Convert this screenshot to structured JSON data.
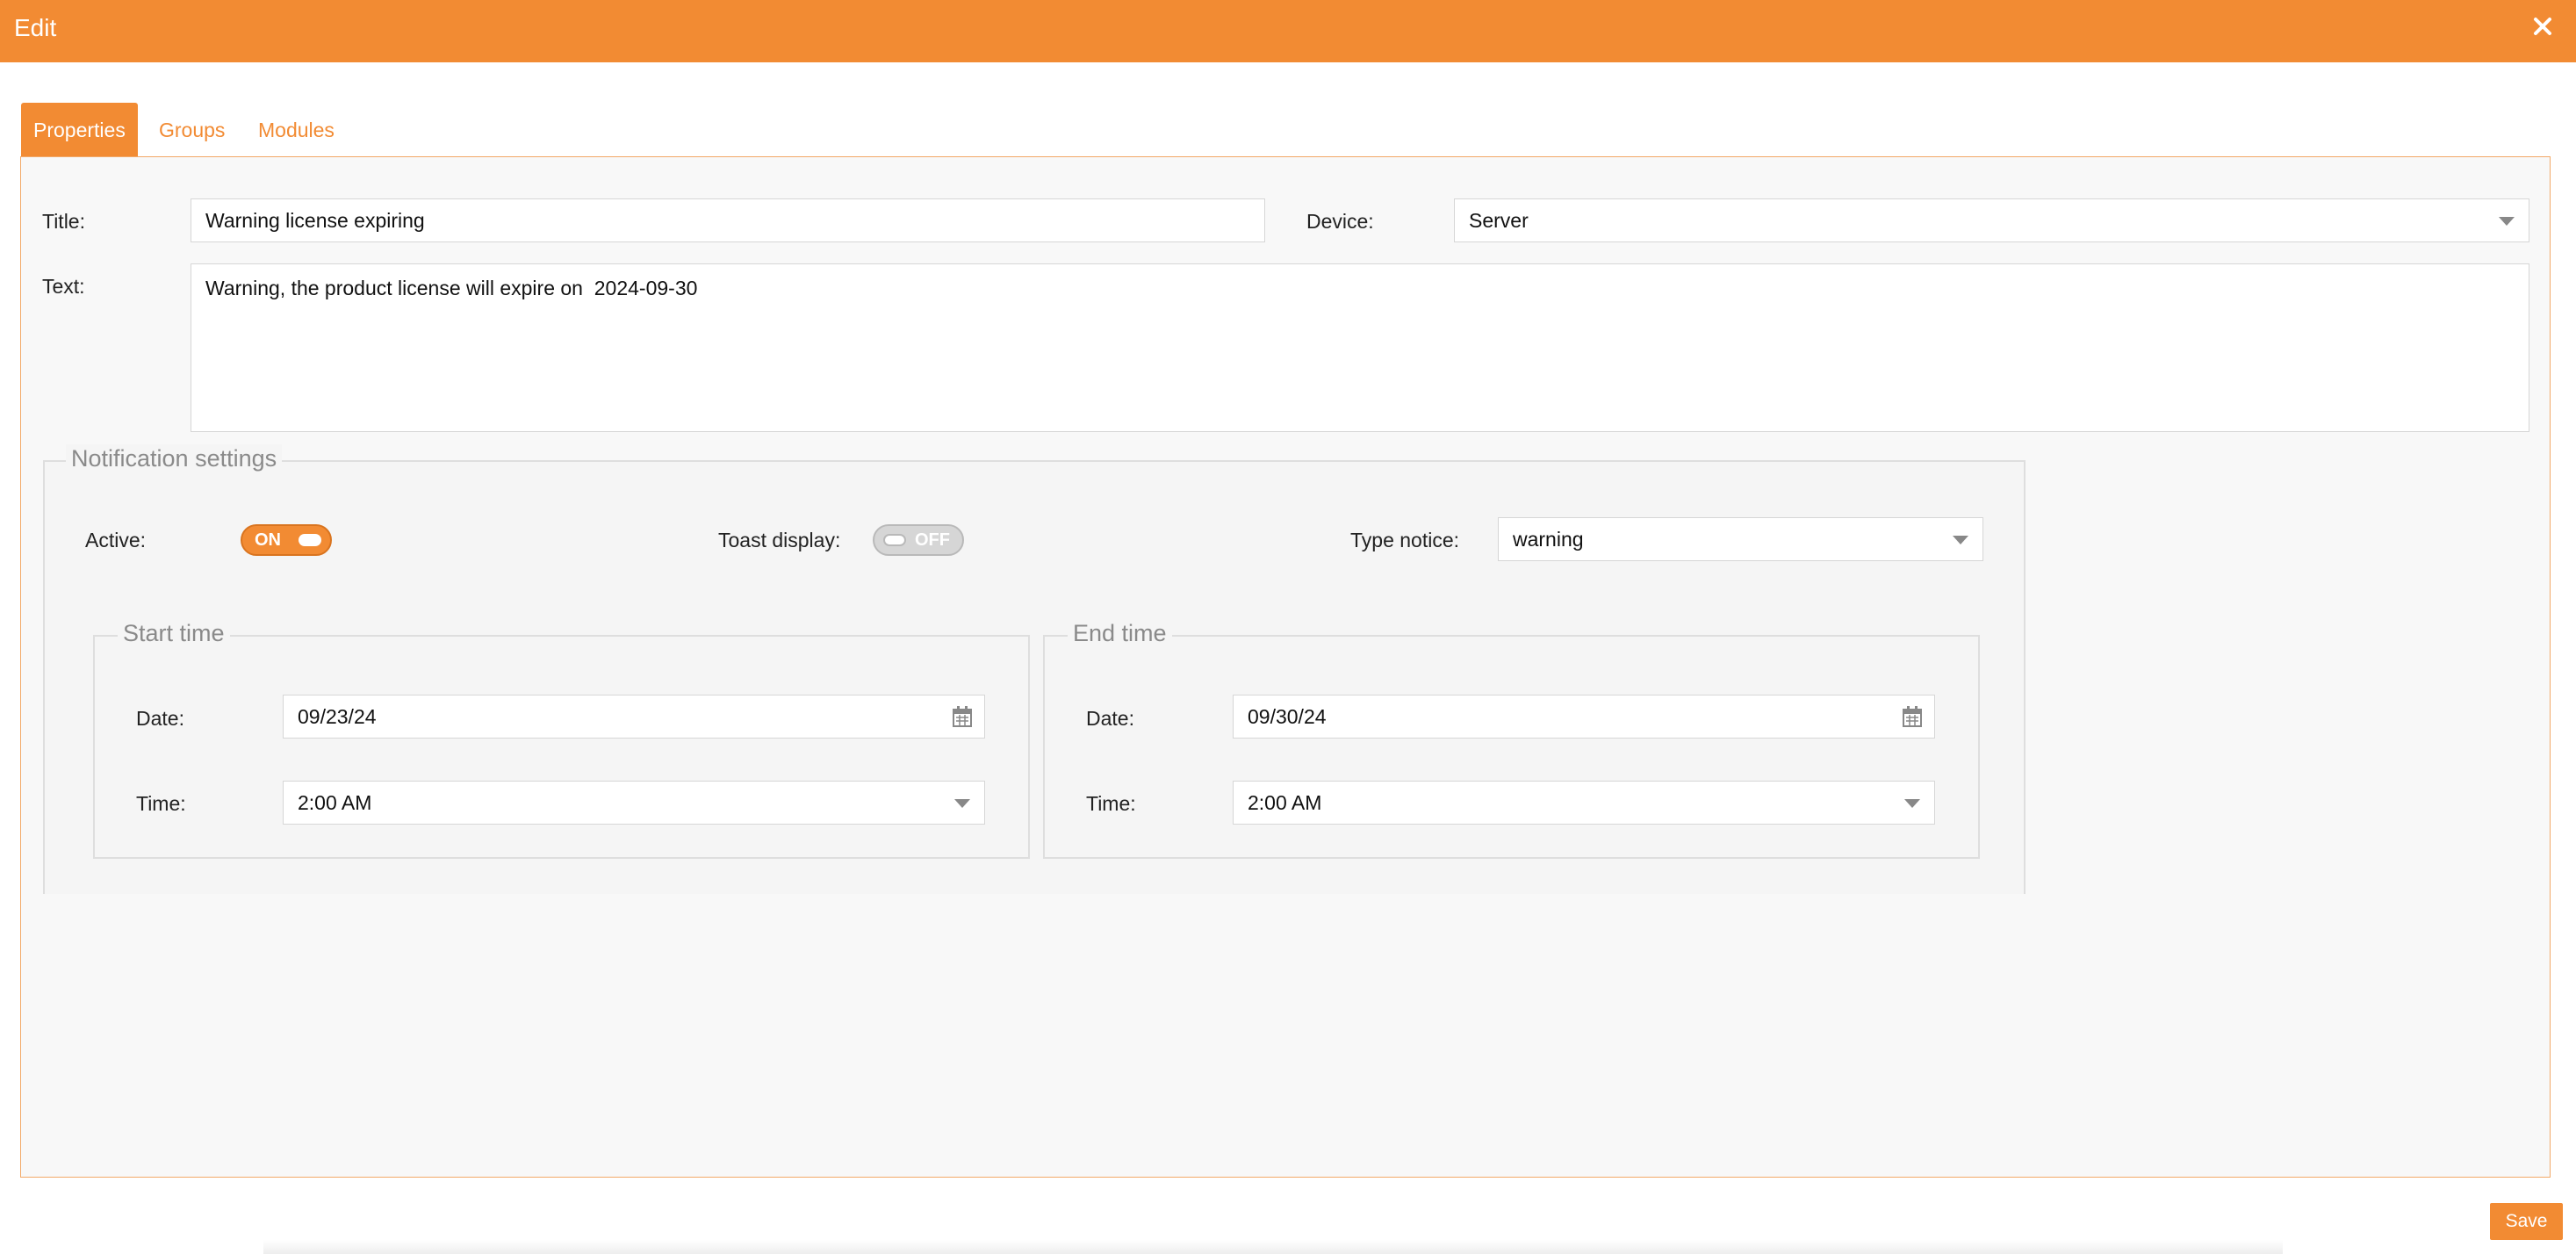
{
  "window": {
    "title": "Edit",
    "close_icon": "close-icon"
  },
  "tabs": [
    {
      "label": "Properties",
      "active": true
    },
    {
      "label": "Groups",
      "active": false
    },
    {
      "label": "Modules",
      "active": false
    }
  ],
  "form": {
    "title_label": "Title:",
    "title_value": "Warning license expiring",
    "device_label": "Device:",
    "device_value": "Server",
    "text_label": "Text:",
    "text_value": "Warning, the product license will expire on  2024-09-30"
  },
  "notification": {
    "legend": "Notification settings",
    "active_label": "Active:",
    "active_toggle": "ON",
    "toast_label": "Toast display:",
    "toast_toggle": "OFF",
    "type_label": "Type notice:",
    "type_value": "warning",
    "start": {
      "legend": "Start time",
      "date_label": "Date:",
      "date_value": "09/23/24",
      "time_label": "Time:",
      "time_value": "2:00 AM"
    },
    "end": {
      "legend": "End time",
      "date_label": "Date:",
      "date_value": "09/30/24",
      "time_label": "Time:",
      "time_value": "2:00 AM"
    }
  },
  "footer": {
    "save_label": "Save"
  },
  "colors": {
    "accent": "#f28b33",
    "panel_bg": "#f8f8f8",
    "border": "#d6d6d6"
  }
}
